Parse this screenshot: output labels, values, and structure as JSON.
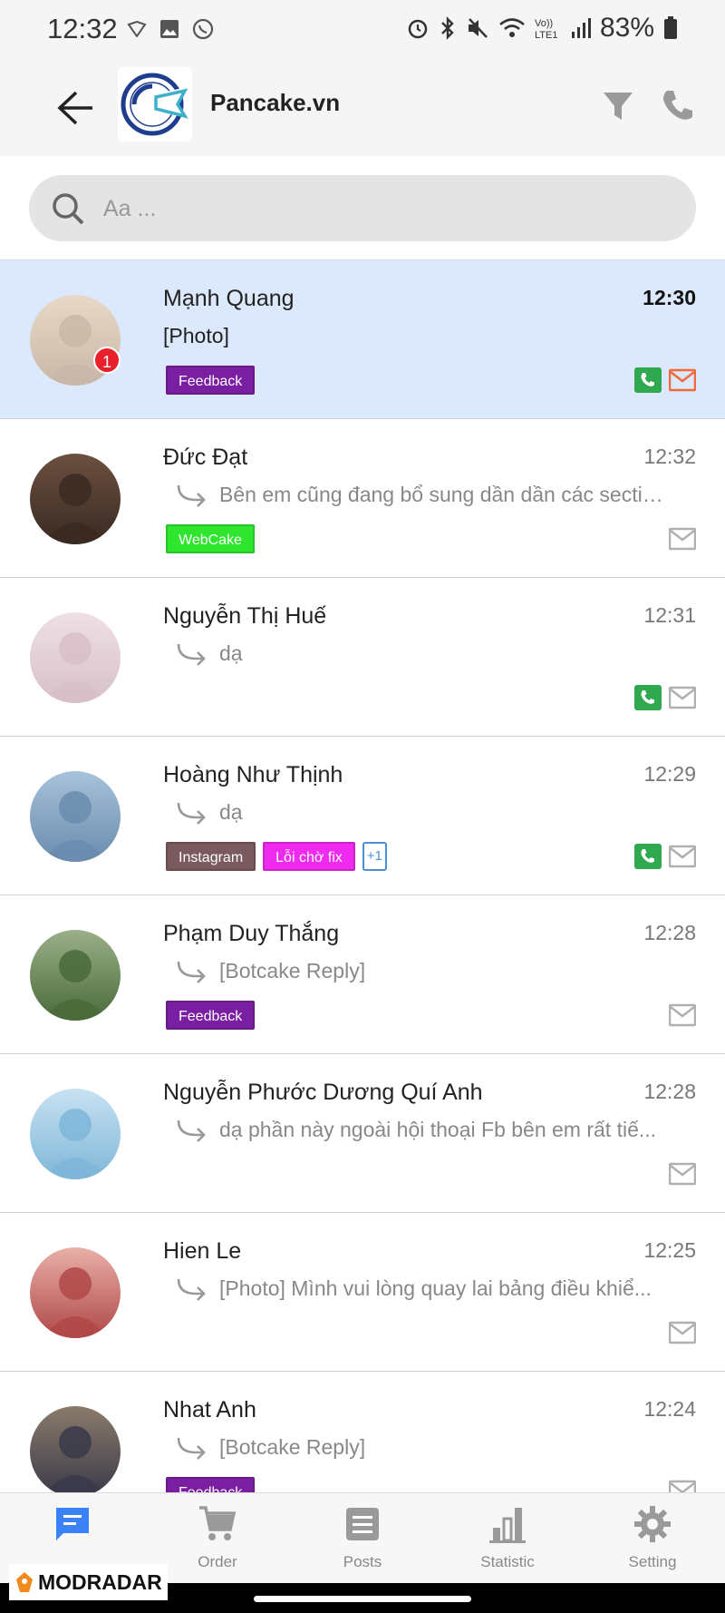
{
  "status_bar": {
    "time": "12:32",
    "battery": "83%",
    "left_icons": [
      "shield-icon",
      "image-icon",
      "whatsapp-icon"
    ],
    "right_icons": [
      "alarm-icon",
      "bluetooth-icon",
      "mute-icon",
      "wifi-icon",
      "volte-icon",
      "signal-icon",
      "battery-icon"
    ]
  },
  "header": {
    "page_name": "Pancake.vn",
    "icons": [
      "back-arrow-icon",
      "filter-icon",
      "phone-icon"
    ]
  },
  "search": {
    "placeholder": "Aa ..."
  },
  "conversations": [
    {
      "name": "Mạnh Quang",
      "time": "12:30",
      "snippet": "[Photo]",
      "unread": true,
      "unread_count": "1",
      "tags": [
        {
          "label": "Feedback",
          "color": "#7b1fa2"
        }
      ],
      "has_phone": true,
      "mail_color": "#f06a3c"
    },
    {
      "name": "Đức Đạt",
      "time": "12:32",
      "snippet": "Bên em cũng đang bổ sung dần dần các sectio...",
      "unread": false,
      "tags": [
        {
          "label": "WebCake",
          "color": "#2ee62e"
        }
      ],
      "has_phone": false,
      "mail_color": "#b0b0b0"
    },
    {
      "name": "Nguyễn Thị Huế",
      "time": "12:31",
      "snippet": "dạ",
      "unread": false,
      "tags": [],
      "has_phone": true,
      "mail_color": "#b0b0b0"
    },
    {
      "name": "Hoàng Như Thịnh",
      "time": "12:29",
      "snippet": "dạ",
      "unread": false,
      "tags": [
        {
          "label": "Instagram",
          "color": "#7a5a5f"
        },
        {
          "label": "Lỗi chờ fix",
          "color": "#ef2bef"
        }
      ],
      "more_tags": "+1",
      "has_phone": true,
      "mail_color": "#b0b0b0"
    },
    {
      "name": "Phạm Duy Thắng",
      "time": "12:28",
      "snippet": "[Botcake Reply]",
      "unread": false,
      "tags": [
        {
          "label": "Feedback",
          "color": "#7b1fa2"
        }
      ],
      "has_phone": false,
      "mail_color": "#b0b0b0"
    },
    {
      "name": "Nguyễn Phước Dương Quí Anh",
      "time": "12:28",
      "snippet": "dạ phần này ngoài hội thoại Fb bên em rất  tiế...",
      "unread": false,
      "tags": [],
      "has_phone": false,
      "mail_color": "#b0b0b0"
    },
    {
      "name": "Hien Le",
      "time": "12:25",
      "snippet": "[Photo] Mình vui lòng quay lai bảng điều khiể...",
      "unread": false,
      "tags": [],
      "has_phone": false,
      "mail_color": "#b0b0b0"
    },
    {
      "name": "Nhat Anh",
      "time": "12:24",
      "snippet": "[Botcake Reply]",
      "unread": false,
      "tags": [
        {
          "label": "Feedback",
          "color": "#7b1fa2"
        }
      ],
      "has_phone": false,
      "mail_color": "#b0b0b0"
    }
  ],
  "bottom_nav": [
    {
      "label": "",
      "icon": "chat-icon",
      "active": true
    },
    {
      "label": "Order",
      "icon": "cart-icon",
      "active": false
    },
    {
      "label": "Posts",
      "icon": "posts-icon",
      "active": false
    },
    {
      "label": "Statistic",
      "icon": "chart-icon",
      "active": false
    },
    {
      "label": "Setting",
      "icon": "gear-icon",
      "active": false
    }
  ],
  "watermark": "MODRADAR",
  "colors": {
    "active_row": "#dce8fb",
    "accent_blue": "#3b82f6",
    "unread_badge": "#e8202c",
    "phone_green": "#2fa84f"
  }
}
